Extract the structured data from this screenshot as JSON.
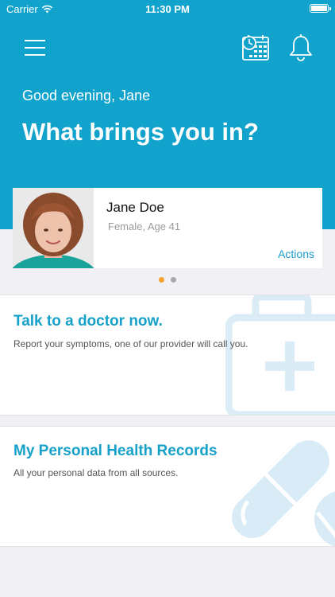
{
  "status_bar": {
    "carrier": "Carrier",
    "time": "11:30 PM"
  },
  "header": {
    "greeting": "Good evening, Jane",
    "headline": "What brings you in?",
    "background_color": "#11a3cc",
    "icons": [
      "menu-icon",
      "schedule-calendar-icon",
      "bell-icon"
    ]
  },
  "profile": {
    "name": "Jane Doe",
    "meta": "Female, Age 41",
    "actions_label": "Actions"
  },
  "pager": {
    "count": 2,
    "active_index": 0,
    "active_color": "#f5a030"
  },
  "cards": [
    {
      "title": "Talk to a doctor now.",
      "subtitle": "Report your symptoms, one of our provider will call you.",
      "icon": "medical-kit-icon"
    },
    {
      "title": "My Personal Health Records",
      "subtitle": "All your personal data from all sources.",
      "icon": "pills-icon"
    }
  ],
  "colors": {
    "accent": "#17a1c9",
    "page_background": "#f0f0f5"
  }
}
